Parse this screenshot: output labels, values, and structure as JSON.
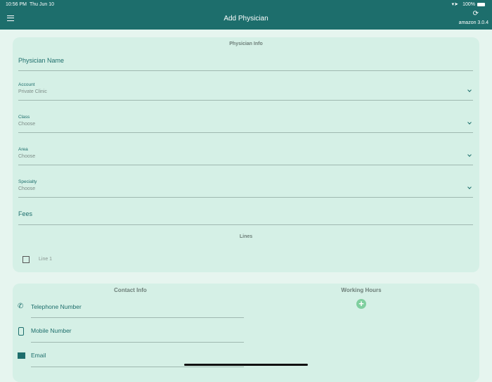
{
  "status": {
    "time": "10:56 PM",
    "date": "Thu Jun 10",
    "battery": "100%"
  },
  "header": {
    "title": "Add Physician",
    "version": "amazon 3.0.4"
  },
  "physician_info": {
    "title": "Physician Info",
    "name_label": "Physician Name",
    "account": {
      "label": "Account",
      "value": "Private Clinic"
    },
    "class": {
      "label": "Class",
      "value": "Choose"
    },
    "area": {
      "label": "Area",
      "value": "Choose"
    },
    "specialty": {
      "label": "Specialty",
      "value": "Choose"
    },
    "fees_label": "Fees",
    "lines_title": "Lines",
    "line1": "Line 1"
  },
  "contact": {
    "title": "Contact Info",
    "telephone": "Telephone Number",
    "mobile": "Mobile Number",
    "email": "Email"
  },
  "working_hours": {
    "title": "Working Hours"
  }
}
